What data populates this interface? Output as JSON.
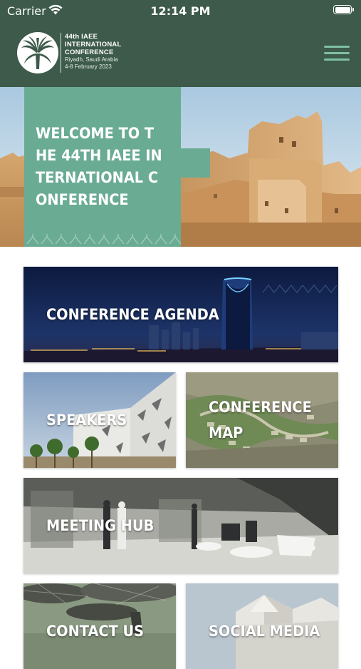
{
  "status_bar": {
    "carrier": "Carrier",
    "time": "12:14 PM",
    "battery_level": 1.0
  },
  "header": {
    "logo_lines": [
      "44th IAEE",
      "INTERNATIONAL",
      "CONFERENCE",
      "Riyadh, Saudi Arabia",
      "4-8 February 2023"
    ],
    "menu_icon": "hamburger-menu-icon"
  },
  "hero": {
    "title": "WELCOME TO THE 44TH IAEE INTERNATIONAL CONFERENCE"
  },
  "tiles": {
    "agenda": "CONFERENCE AGENDA",
    "speakers": "SPEAKERS",
    "map_line1": "CONFERENCE",
    "map_line2": "MAP",
    "hub": "MEETING HUB",
    "contact": "CONTACT US",
    "social": "SOCIAL MEDIA"
  },
  "colors": {
    "header_green": "#3d5a4a",
    "accent_green": "#6aab94",
    "menu_icon": "#7fbfa6"
  }
}
